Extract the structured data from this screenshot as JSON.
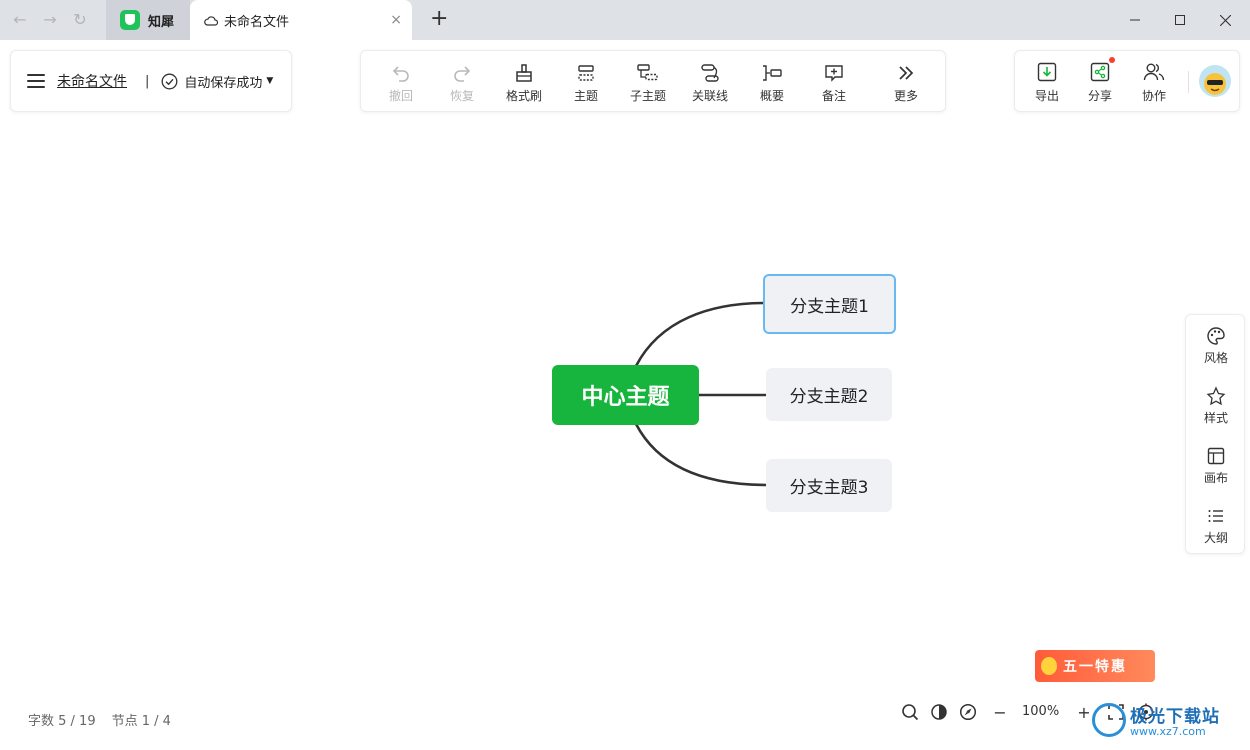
{
  "browser": {
    "app_tab_label": "知犀",
    "doc_tab_label": "未命名文件",
    "close_tab": "×",
    "new_tab": "+"
  },
  "file_panel": {
    "file_name": "未命名文件",
    "separator": "|",
    "save_status": "自动保存成功"
  },
  "toolbar": {
    "items": [
      {
        "label": "撤回",
        "icon": "undo-icon",
        "enabled": false
      },
      {
        "label": "恢复",
        "icon": "redo-icon",
        "enabled": false
      },
      {
        "label": "格式刷",
        "icon": "format-brush-icon",
        "enabled": true
      },
      {
        "label": "主题",
        "icon": "topic-icon",
        "enabled": true
      },
      {
        "label": "子主题",
        "icon": "subtopic-icon",
        "enabled": true
      },
      {
        "label": "关联线",
        "icon": "relation-line-icon",
        "enabled": true
      },
      {
        "label": "概要",
        "icon": "summary-icon",
        "enabled": true
      },
      {
        "label": "备注",
        "icon": "note-icon",
        "enabled": true
      },
      {
        "label": "更多",
        "icon": "more-icon",
        "enabled": true
      }
    ]
  },
  "right_panel": {
    "items": [
      {
        "label": "导出",
        "icon": "export-icon"
      },
      {
        "label": "分享",
        "icon": "share-icon"
      },
      {
        "label": "协作",
        "icon": "collaborate-icon"
      }
    ]
  },
  "side_panel": {
    "items": [
      {
        "label": "风格",
        "icon": "palette-icon"
      },
      {
        "label": "样式",
        "icon": "style-icon"
      },
      {
        "label": "画布",
        "icon": "canvas-icon"
      },
      {
        "label": "大纲",
        "icon": "outline-icon"
      }
    ]
  },
  "mindmap": {
    "central": "中心主题",
    "branches": [
      "分支主题1",
      "分支主题2",
      "分支主题3"
    ],
    "selected_branch": 0
  },
  "status": {
    "word_count": "字数 5 / 19",
    "node_count": "节点 1 / 4"
  },
  "zoom": {
    "level": "100%",
    "minus": "−",
    "plus": "+"
  },
  "promo": {
    "label": "五一特惠"
  },
  "watermark": {
    "title": "极光下载站",
    "url": "www.xz7.com"
  },
  "colors": {
    "accent_green": "#17b53d",
    "selection_blue": "#69b8f0",
    "branch_bg": "#eff1f4"
  }
}
